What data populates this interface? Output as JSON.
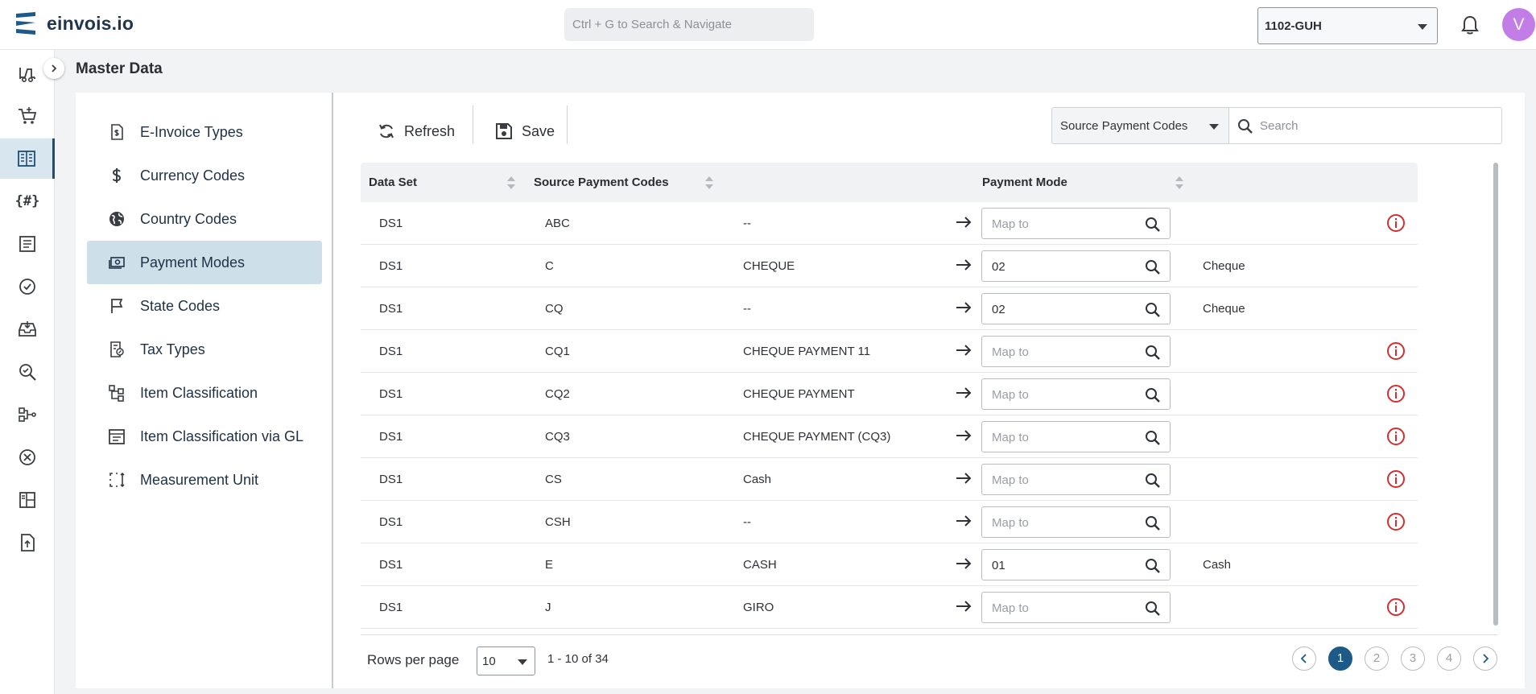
{
  "app": {
    "name": "einvois.io",
    "search_placeholder": "Ctrl + G to Search & Navigate",
    "company": "1102-GUH",
    "avatar_initial": "V",
    "brand_color": "#1d5a88"
  },
  "page": {
    "title": "Master Data"
  },
  "menu": [
    {
      "label": "E-Invoice Types",
      "icon": "invoice-dollar-icon"
    },
    {
      "label": "Currency Codes",
      "icon": "dollar-icon"
    },
    {
      "label": "Country Codes",
      "icon": "globe-icon"
    },
    {
      "label": "Payment Modes",
      "icon": "money-icon",
      "active": true
    },
    {
      "label": "State Codes",
      "icon": "flag-icon"
    },
    {
      "label": "Tax Types",
      "icon": "tax-document-icon"
    },
    {
      "label": "Item Classification",
      "icon": "hierarchy-icon"
    },
    {
      "label": "Item Classification via GL",
      "icon": "ledger-icon"
    },
    {
      "label": "Measurement Unit",
      "icon": "measure-icon"
    }
  ],
  "toolbar": {
    "refresh_label": "Refresh",
    "save_label": "Save",
    "filter_value": "Source Payment Codes",
    "search_placeholder": "Search"
  },
  "table": {
    "headers": {
      "dataset": "Data Set",
      "source": "Source Payment Codes",
      "payment_mode": "Payment Mode"
    },
    "map_placeholder": "Map to",
    "rows": [
      {
        "dataset": "DS1",
        "code": "ABC",
        "desc": "--",
        "mapped": "",
        "mapped_desc": "",
        "warning": true
      },
      {
        "dataset": "DS1",
        "code": "C",
        "desc": "CHEQUE",
        "mapped": "02",
        "mapped_desc": "Cheque",
        "warning": false
      },
      {
        "dataset": "DS1",
        "code": "CQ",
        "desc": "--",
        "mapped": "02",
        "mapped_desc": "Cheque",
        "warning": false
      },
      {
        "dataset": "DS1",
        "code": "CQ1",
        "desc": "CHEQUE PAYMENT 11",
        "mapped": "",
        "mapped_desc": "",
        "warning": true
      },
      {
        "dataset": "DS1",
        "code": "CQ2",
        "desc": "CHEQUE PAYMENT",
        "mapped": "",
        "mapped_desc": "",
        "warning": true
      },
      {
        "dataset": "DS1",
        "code": "CQ3",
        "desc": "CHEQUE PAYMENT (CQ3)",
        "mapped": "",
        "mapped_desc": "",
        "warning": true
      },
      {
        "dataset": "DS1",
        "code": "CS",
        "desc": "Cash",
        "mapped": "",
        "mapped_desc": "",
        "warning": true
      },
      {
        "dataset": "DS1",
        "code": "CSH",
        "desc": "--",
        "mapped": "",
        "mapped_desc": "",
        "warning": true
      },
      {
        "dataset": "DS1",
        "code": "E",
        "desc": "CASH",
        "mapped": "01",
        "mapped_desc": "Cash",
        "warning": false
      },
      {
        "dataset": "DS1",
        "code": "J",
        "desc": "GIRO",
        "mapped": "",
        "mapped_desc": "",
        "warning": true
      }
    ]
  },
  "pagination": {
    "rows_per_page_label": "Rows per page",
    "rows_per_page": "10",
    "range": "1 - 10 of 34",
    "pages": [
      "1",
      "2",
      "3",
      "4"
    ],
    "current": "1"
  }
}
